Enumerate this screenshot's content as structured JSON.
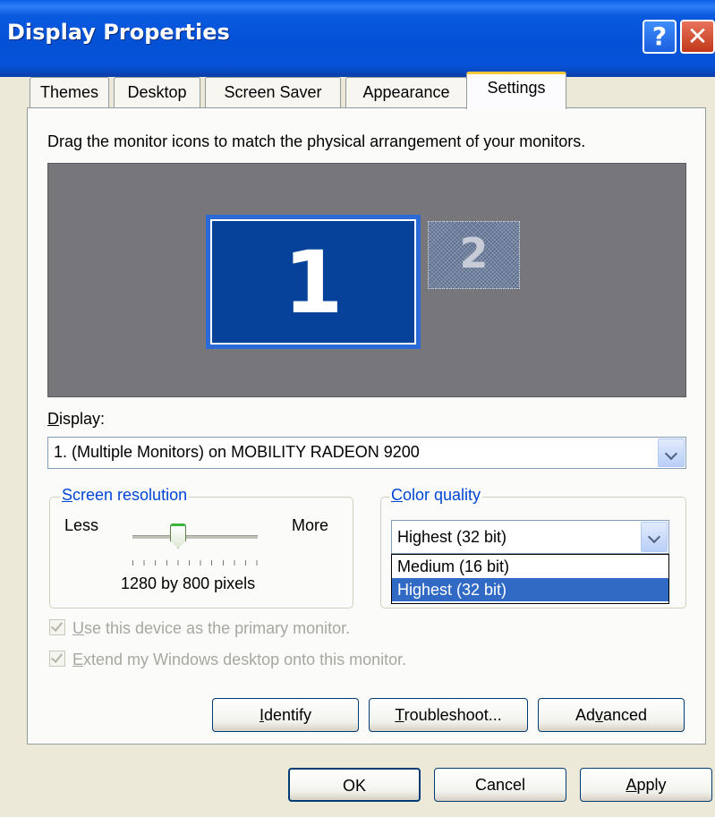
{
  "window": {
    "title": "Display Properties"
  },
  "titlebar_buttons": {
    "help_label": "?",
    "close_label": "✕"
  },
  "tabs": [
    {
      "label": "Themes"
    },
    {
      "label": "Desktop"
    },
    {
      "label": "Screen Saver"
    },
    {
      "label": "Appearance"
    },
    {
      "label": "Settings",
      "active": true
    }
  ],
  "instructions": "Drag the monitor icons to match the physical arrangement of your monitors.",
  "monitors": [
    {
      "label": "1",
      "selected": true
    },
    {
      "label": "2",
      "selected": false
    }
  ],
  "display": {
    "label_prefix": "D",
    "label_rest": "isplay:",
    "value": "1. (Multiple Monitors) on MOBILITY RADEON 9200"
  },
  "resolution": {
    "legend_first": "S",
    "legend_rest": "creen resolution",
    "less": "Less",
    "more": "More",
    "value_text": "1280 by 800 pixels"
  },
  "color_quality": {
    "legend_first": "C",
    "legend_rest": "olor quality",
    "selected": "Highest (32 bit)",
    "options": [
      "Medium (16 bit)",
      "Highest (32 bit)"
    ]
  },
  "checkboxes": {
    "primary_first": "U",
    "primary_rest": "se this device as the primary monitor.",
    "extend_first": "E",
    "extend_rest": "xtend my Windows desktop onto this monitor."
  },
  "buttons": {
    "identify_first": "I",
    "identify_rest": "dentify",
    "troubleshoot_first": "T",
    "troubleshoot_rest": "roubleshoot...",
    "advanced_a": "Ad",
    "advanced_u": "v",
    "advanced_b": "anced",
    "ok": "OK",
    "cancel": "Cancel",
    "apply_first": "A",
    "apply_rest": "pply"
  },
  "colors": {
    "titlebar": "#0451d6",
    "monitor_area": "#76767b",
    "selection": "#316ac5",
    "tab_accent": "#ffc83c"
  }
}
